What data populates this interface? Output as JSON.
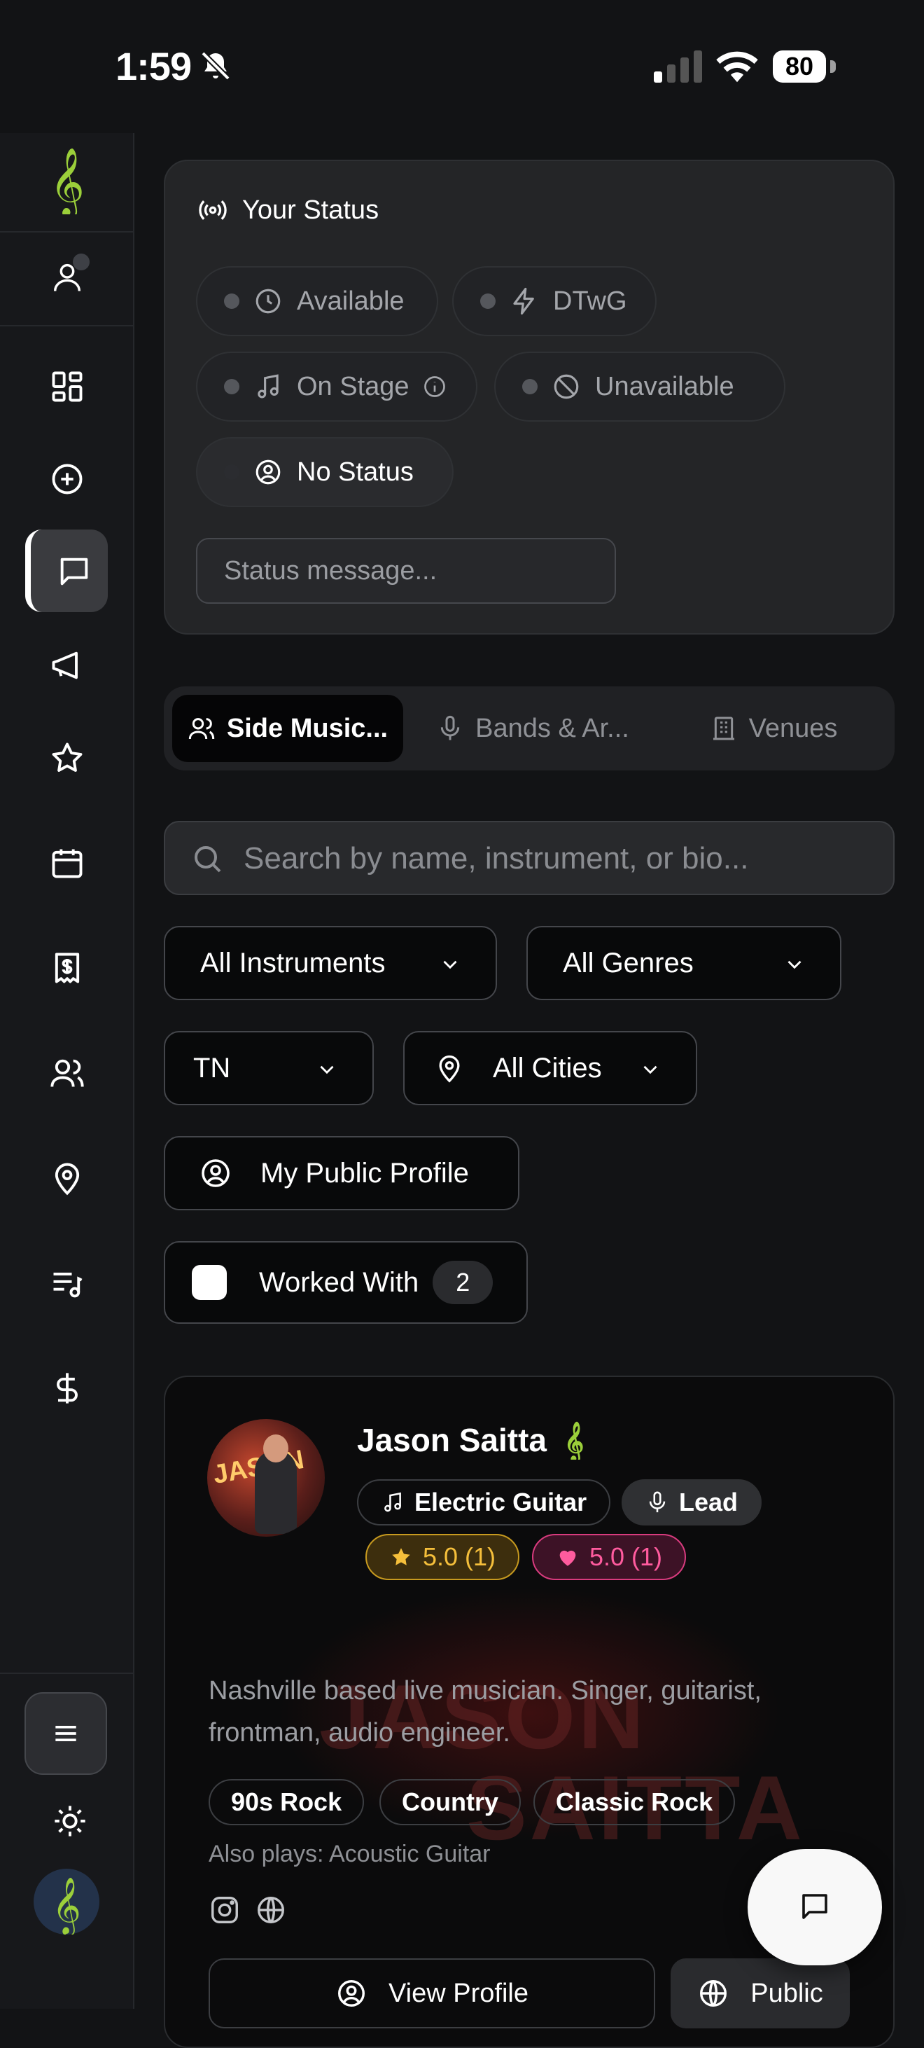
{
  "status_bar": {
    "time": "1:59",
    "battery": "80"
  },
  "status_card": {
    "title": "Your Status",
    "options": [
      {
        "label": "Available"
      },
      {
        "label": "DTwG"
      },
      {
        "label": "On Stage"
      },
      {
        "label": "Unavailable"
      },
      {
        "label": "No Status"
      }
    ],
    "message_placeholder": "Status message..."
  },
  "tabs": [
    {
      "label": "Side Music..."
    },
    {
      "label": "Bands & Ar..."
    },
    {
      "label": "Venues"
    }
  ],
  "search": {
    "placeholder": "Search by name, instrument, or bio..."
  },
  "filters": {
    "instruments": "All Instruments",
    "genres": "All Genres",
    "state": "TN",
    "cities": "All Cities",
    "public_profile": "My Public Profile",
    "worked_with": "Worked With",
    "worked_with_count": "2"
  },
  "profile": {
    "name": "Jason Saitta",
    "avatar_text": "JASON",
    "watermark_line1": "JASON",
    "watermark_line2": "SAITTA",
    "instrument": "Electric Guitar",
    "role": "Lead",
    "rating_star": "5.0 (1)",
    "rating_heart": "5.0 (1)",
    "bio": "Nashville based live musician. Singer, guitarist, frontman, audio engineer.",
    "genres": [
      "90s Rock",
      "Country",
      "Classic Rock"
    ],
    "also_plays": "Also plays: Acoustic Guitar",
    "view_profile": "View Profile",
    "visibility": "Public"
  },
  "colors": {
    "accent_green": "#9bcf3a",
    "star": "#f5bf3b",
    "heart": "#ff5b9e"
  }
}
